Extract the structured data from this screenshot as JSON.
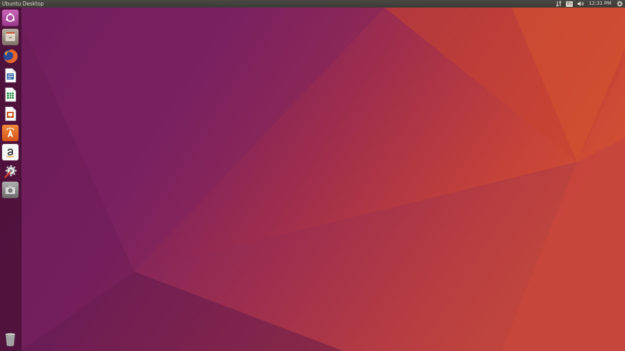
{
  "panel": {
    "title": "Ubuntu Desktop",
    "clock": "12:31 PM",
    "indicators": [
      "network-icon",
      "keyboard-layout-icon",
      "volume-icon",
      "settings-gear-icon"
    ],
    "keyboard_layout": "En"
  },
  "launcher": {
    "items": [
      {
        "icon": "dash-home-icon",
        "color": "#b64ea8"
      },
      {
        "icon": "files-icon",
        "color": "#9a8b7e"
      },
      {
        "icon": "firefox-icon",
        "color": "#e8662a"
      },
      {
        "icon": "libreoffice-writer-icon",
        "color": "#2a5ea8"
      },
      {
        "icon": "libreoffice-calc-icon",
        "color": "#1f8a3c"
      },
      {
        "icon": "libreoffice-impress-icon",
        "color": "#c65a1e"
      },
      {
        "icon": "software-center-icon",
        "color": "#e86a1e"
      },
      {
        "icon": "amazon-icon",
        "color": "#ffffff"
      },
      {
        "icon": "system-settings-icon",
        "color": "#d33a2a"
      },
      {
        "icon": "screenshot-icon",
        "color": "#8a8a8a"
      },
      {
        "icon": "trash-icon",
        "color": "#9a9a9a"
      }
    ]
  },
  "colors": {
    "panel": "#3c3b37",
    "launcher": "#461034",
    "wallpaper_purple": "#6e1f5e",
    "wallpaper_orange": "#d4532e"
  }
}
